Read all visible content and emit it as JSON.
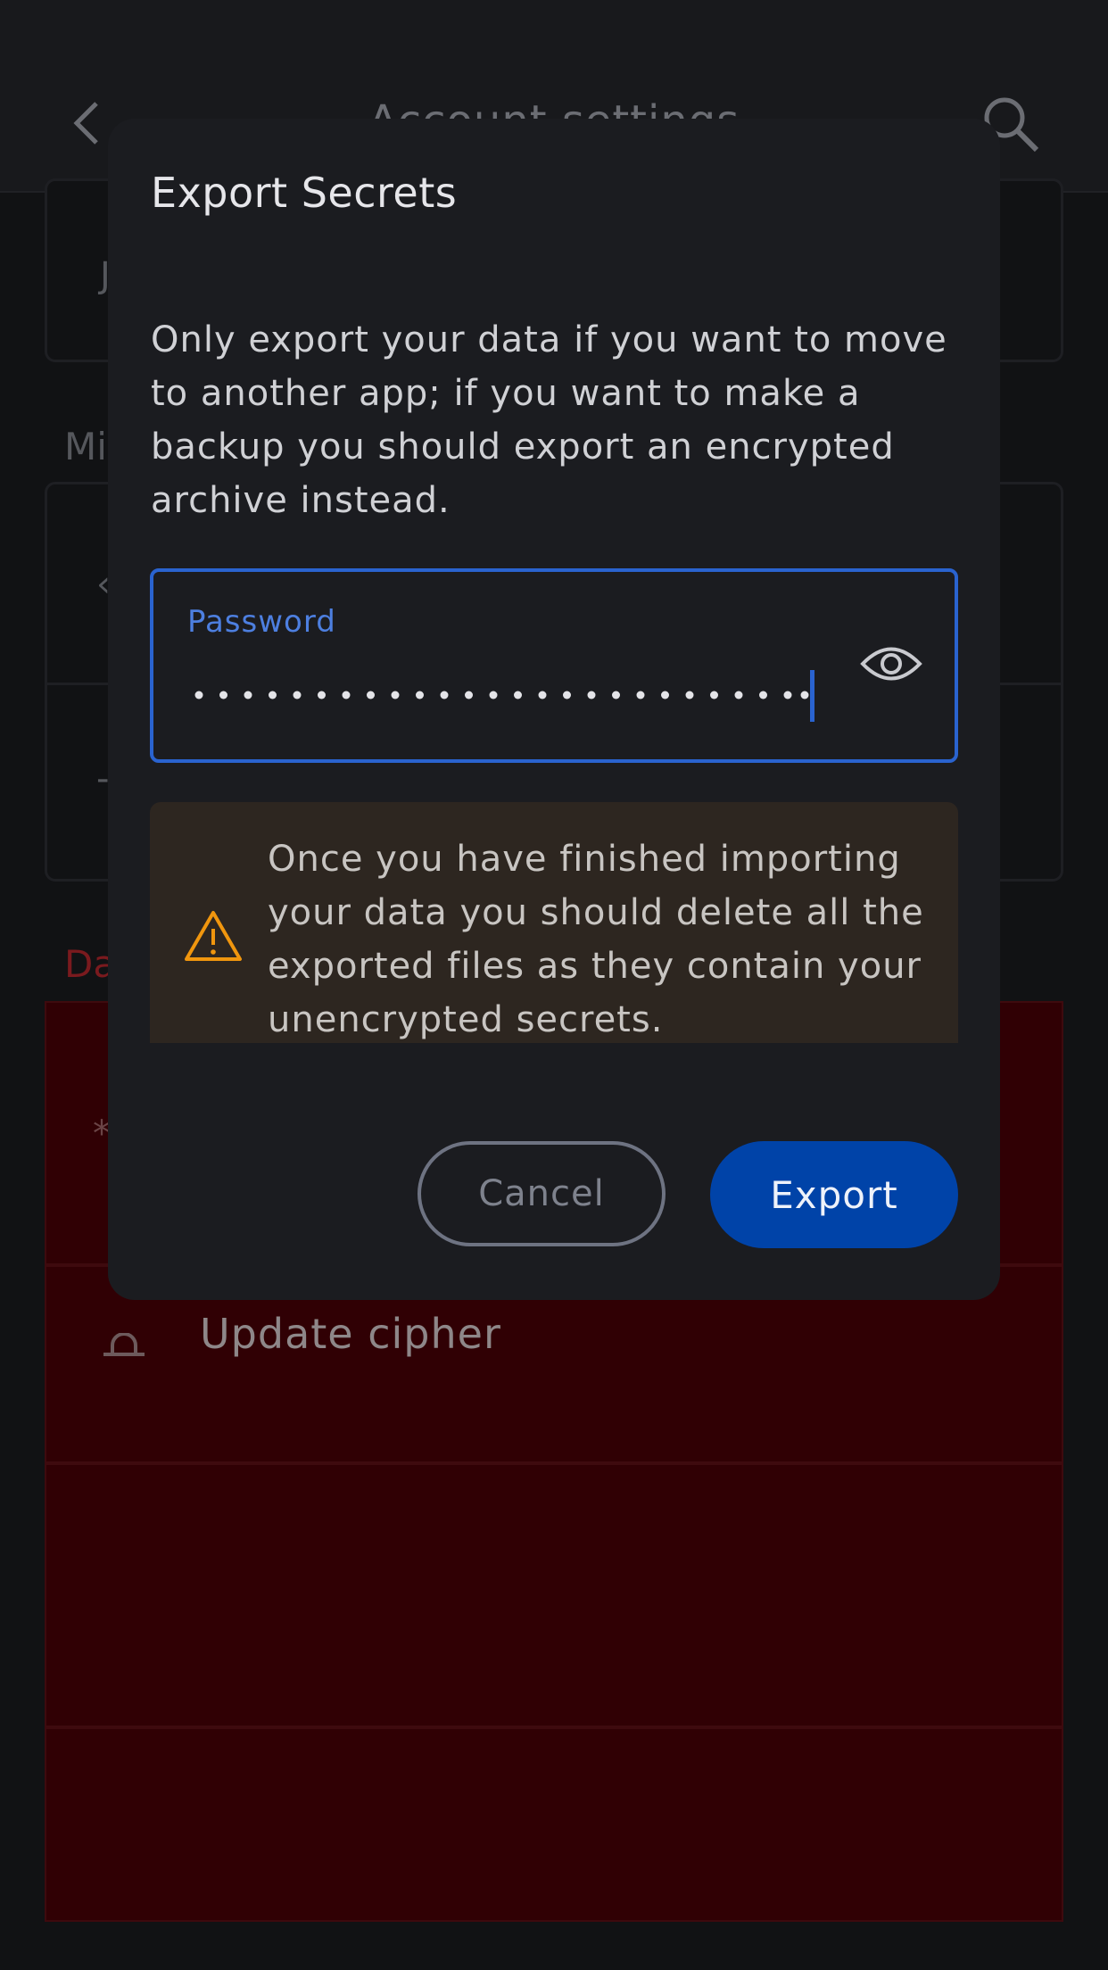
{
  "app_bar": {
    "title": "Account settings",
    "back_icon": "chevron-left-icon",
    "search_icon": "search-icon"
  },
  "background": {
    "section_partial_1": "Mi",
    "section_partial_2": "Da",
    "update_cipher_label": "Update cipher",
    "lock_icon": "lock-icon"
  },
  "dialog": {
    "title": "Export Secrets",
    "body": "Only export your data if you want to move to another app; if you want to make a backup you should export an encrypted archive instead.",
    "password_label": "Password",
    "password_mask": "••••••••••••••••••••••••••",
    "visibility_icon": "eye-icon",
    "warning_icon": "warning-triangle-icon",
    "warning_text": "Once you have finished importing your data you should delete all the exported files as they contain your unencrypted secrets.",
    "cancel_label": "Cancel",
    "export_label": "Export"
  },
  "colors": {
    "accent": "#2a63cf",
    "primary_button": "#0043a8",
    "warning": "#f0960e",
    "danger_bg": "#300004"
  }
}
